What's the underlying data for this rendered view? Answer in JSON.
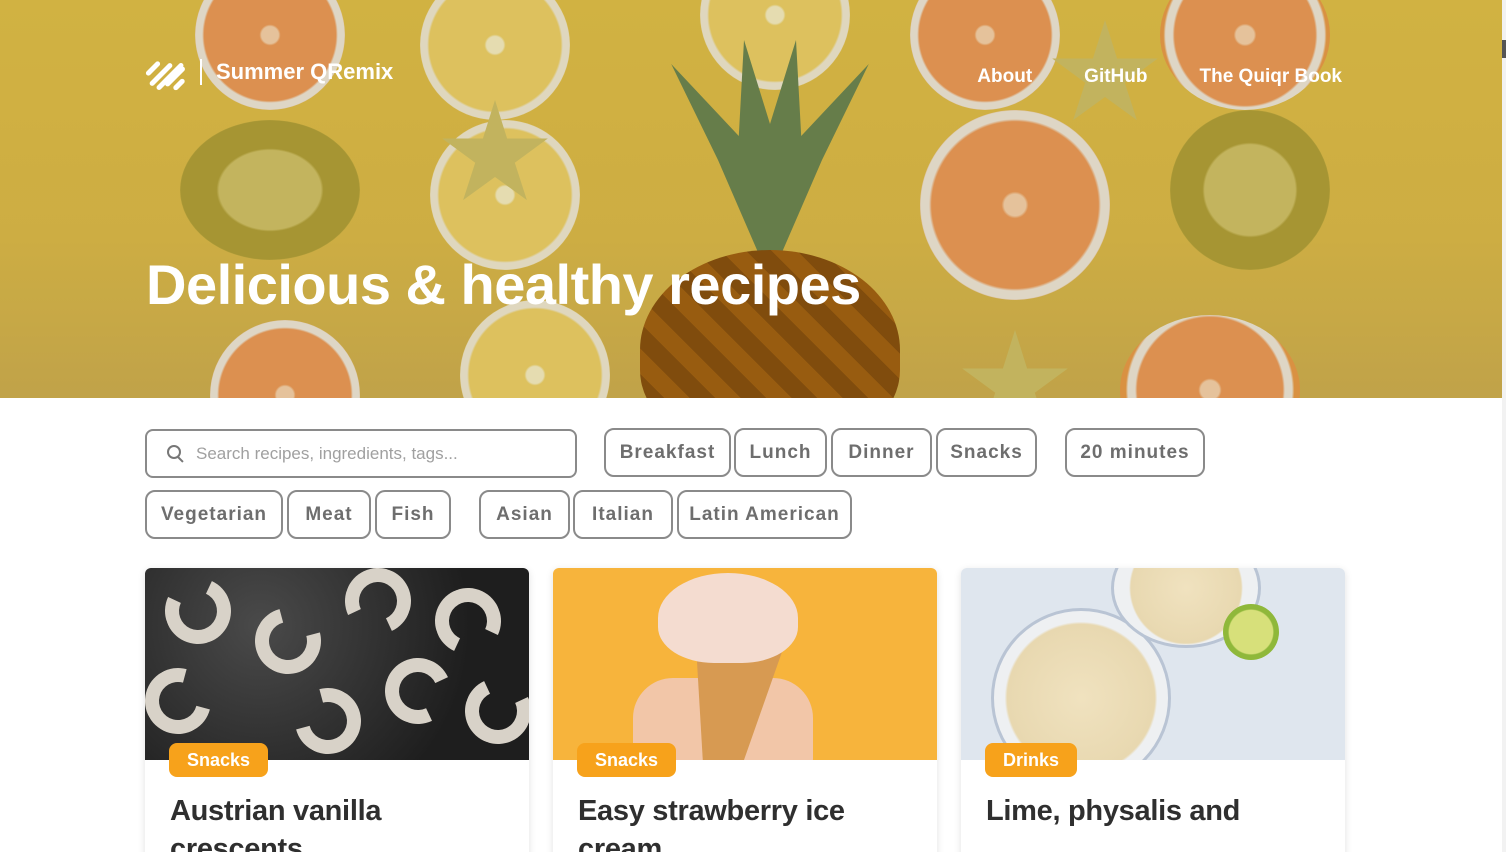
{
  "header": {
    "brand_name": "Summer QRemix",
    "nav": [
      "About",
      "GitHub",
      "The Quiqr Book"
    ]
  },
  "hero": {
    "title": "Delicious & healthy recipes"
  },
  "search": {
    "placeholder": "Search recipes, ingredients, tags..."
  },
  "filters": {
    "meal": [
      "Breakfast",
      "Lunch",
      "Dinner",
      "Snacks"
    ],
    "time": [
      "20 minutes"
    ],
    "diet": [
      "Vegetarian",
      "Meat",
      "Fish"
    ],
    "cuisine": [
      "Asian",
      "Italian",
      "Latin American"
    ]
  },
  "cards": [
    {
      "category": "Snacks",
      "title": "Austrian vanilla crescents"
    },
    {
      "category": "Snacks",
      "title": "Easy strawberry ice cream"
    },
    {
      "category": "Drinks",
      "title": "Lime, physalis and"
    }
  ],
  "colors": {
    "accent": "#f7a21b",
    "tag_border": "#8a8a8a",
    "tag_text": "#6e6e6e",
    "title_text": "#2f2f2f"
  }
}
